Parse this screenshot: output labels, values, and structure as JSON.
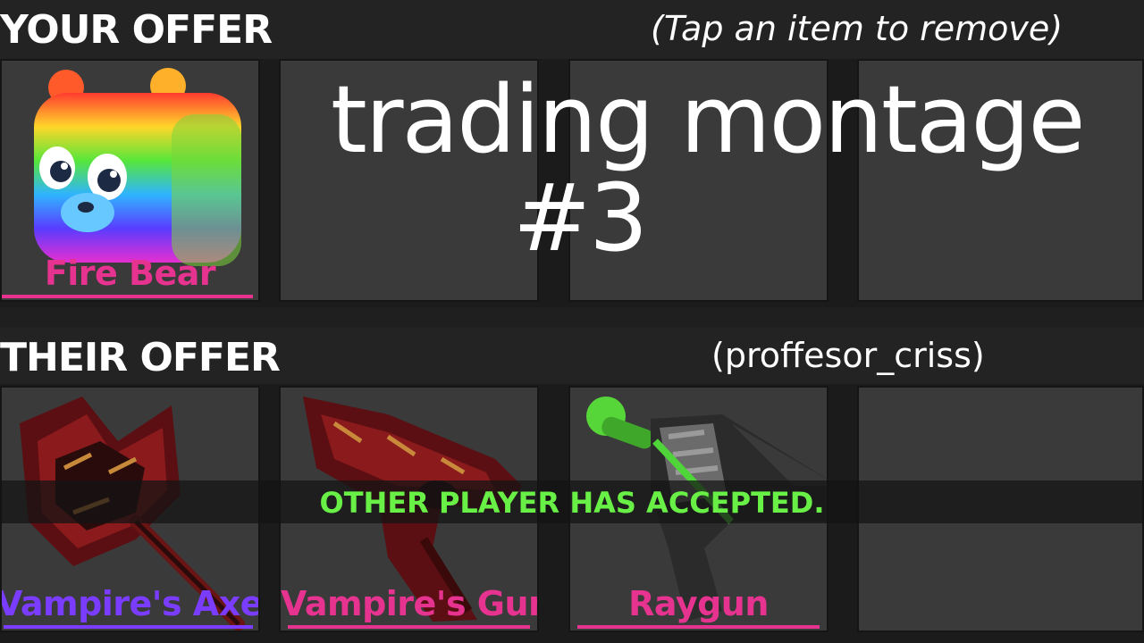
{
  "your_offer": {
    "title": "YOUR OFFER",
    "hint": "(Tap an item to remove)",
    "slots": [
      {
        "name": "Fire Bear",
        "color": "#e6338f",
        "icon": "rainbow-bear-icon"
      },
      {
        "name": "",
        "icon": ""
      },
      {
        "name": "",
        "icon": ""
      },
      {
        "name": "",
        "icon": ""
      }
    ]
  },
  "their_offer": {
    "title": "THEIR OFFER",
    "partner": "(proffesor_criss)",
    "slots": [
      {
        "name": "Vampire's Axe",
        "color": "#7a3cff",
        "icon": "vampire-axe-icon"
      },
      {
        "name": "Vampire's Gun",
        "color": "#e6338f",
        "icon": "vampire-gun-icon"
      },
      {
        "name": "Raygun",
        "color": "#e6338f",
        "icon": "raygun-icon"
      },
      {
        "name": "",
        "icon": ""
      }
    ]
  },
  "overlay": {
    "line1": "trading montage",
    "line2": "#3"
  },
  "status": {
    "text": "OTHER PLAYER HAS ACCEPTED.",
    "color": "#69f046"
  }
}
